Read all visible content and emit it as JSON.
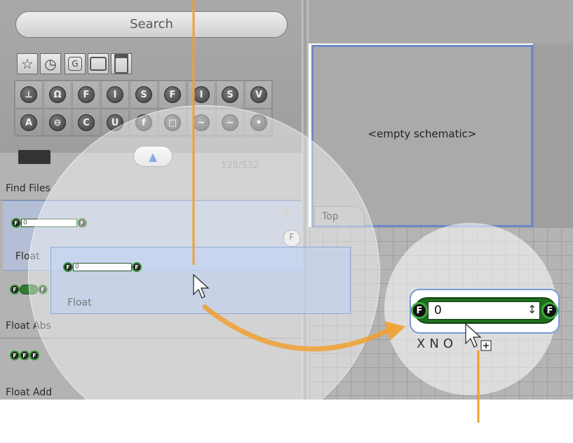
{
  "search": {
    "placeholder": "Search"
  },
  "toolbar": {
    "buttons": [
      {
        "icon": "star-icon",
        "glyph": "☆"
      },
      {
        "icon": "clock-icon",
        "glyph": "◷"
      },
      {
        "icon": "group-icon",
        "glyph": "G"
      },
      {
        "icon": "rectangle-icon",
        "glyph": ""
      },
      {
        "icon": "panel-icon",
        "glyph": ""
      }
    ]
  },
  "categories": {
    "row1": [
      "⊥",
      "Ω",
      "F",
      "I",
      "S",
      "F",
      "I",
      "S",
      "V"
    ],
    "row2": [
      "A",
      "⊖",
      "C",
      "U",
      "f",
      "□",
      "~",
      "~",
      "•"
    ]
  },
  "list": {
    "count": "128/532",
    "items": [
      {
        "label": "Find Files"
      },
      {
        "label": "Float",
        "chip": "F",
        "value": "0"
      },
      {
        "label": "Float Abs",
        "chip": "F"
      },
      {
        "label": "Float Add"
      }
    ]
  },
  "drag_ghost": {
    "label": "Float",
    "value": "0"
  },
  "schematic": {
    "empty_text": "<empty schematic>",
    "tab": "Top"
  },
  "zoomed_node": {
    "value": "0",
    "port_left": "F",
    "port_right": "F",
    "actions": [
      "X",
      "N",
      "O"
    ]
  },
  "colors": {
    "node_green": "#1f6e1f",
    "selection_blue": "#7c9ad8",
    "annotation_orange": "#f0a030"
  }
}
